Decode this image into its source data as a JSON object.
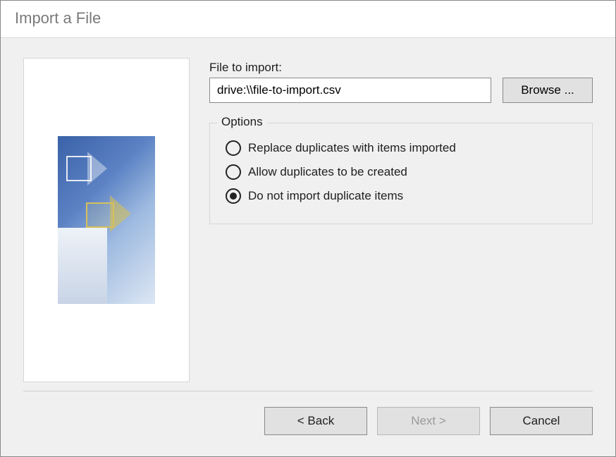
{
  "window": {
    "title": "Import a File"
  },
  "form": {
    "file_label": "File to import:",
    "file_value": "drive:\\\\file-to-import.csv",
    "browse_label": "Browse ..."
  },
  "options": {
    "legend": "Options",
    "items": [
      {
        "label": "Replace duplicates with items imported",
        "checked": false
      },
      {
        "label": "Allow duplicates to be created",
        "checked": false
      },
      {
        "label": "Do not import duplicate items",
        "checked": true
      }
    ]
  },
  "buttons": {
    "back": "< Back",
    "next": "Next >",
    "cancel": "Cancel",
    "next_enabled": false
  }
}
